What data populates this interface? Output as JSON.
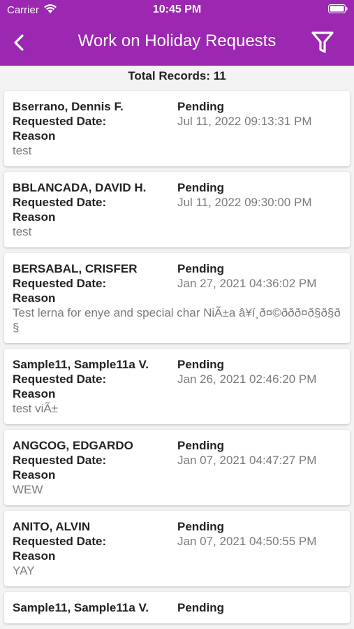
{
  "status_bar": {
    "carrier": "Carrier",
    "time": "10:45 PM"
  },
  "header": {
    "title": "Work on Holiday Requests",
    "icons": [
      "chevron-left-icon",
      "filter-icon"
    ],
    "color": "#9c27b0"
  },
  "summary": {
    "total_records": "Total Records: 11"
  },
  "labels": {
    "requested_date": "Requested Date:",
    "reason": "Reason"
  },
  "records": [
    {
      "name": "Bserrano, Dennis F.",
      "status": "Pending",
      "date": "Jul 11, 2022 09:13:31 PM",
      "reason": "test"
    },
    {
      "name": "BBLANCADA, DAVID H.",
      "status": "Pending",
      "date": "Jul 11, 2022 09:30:00 PM",
      "reason": "test"
    },
    {
      "name": "BERSABAL, CRISFER",
      "status": "Pending",
      "date": "Jan 27, 2021 04:36:02 PM",
      "reason": "Test lerna for enye and special char NiÃ±a â¥í¸ð¤©ððð¤ð§ð§ð§"
    },
    {
      "name": "Sample11, Sample11a V.",
      "status": "Pending",
      "date": "Jan 26, 2021 02:46:20 PM",
      "reason": "test viÃ±"
    },
    {
      "name": "ANGCOG, EDGARDO",
      "status": "Pending",
      "date": "Jan 07, 2021 04:47:27 PM",
      "reason": "WEW"
    },
    {
      "name": "ANITO, ALVIN",
      "status": "Pending",
      "date": "Jan 07, 2021 04:50:55 PM",
      "reason": "YAY"
    },
    {
      "name": "Sample11, Sample11a V.",
      "status": "Pending",
      "date": "",
      "reason": ""
    }
  ]
}
